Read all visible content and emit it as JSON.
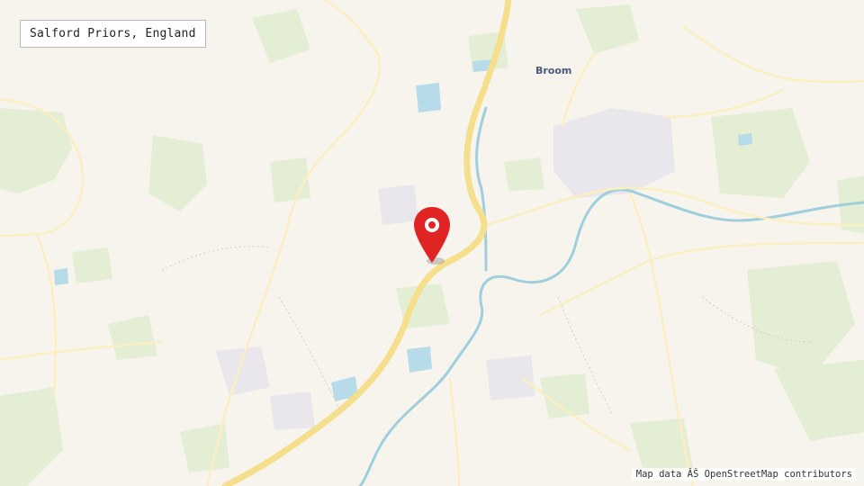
{
  "location_label": "Salford Priors, England",
  "places": [
    {
      "name": "Broom"
    }
  ],
  "attribution": "Map data ÂŠ OpenStreetMap contributors",
  "colors": {
    "background": "#f7f4ee",
    "woodland": "#e3eed4",
    "water": "#b7dbe8",
    "river": "#9fcfdd",
    "main_road": "#f6df8c",
    "minor_road": "#fbeec0",
    "built_up": "#e9e6ec",
    "marker": "#e02424"
  },
  "icons": {
    "marker": "map-pin-icon"
  }
}
